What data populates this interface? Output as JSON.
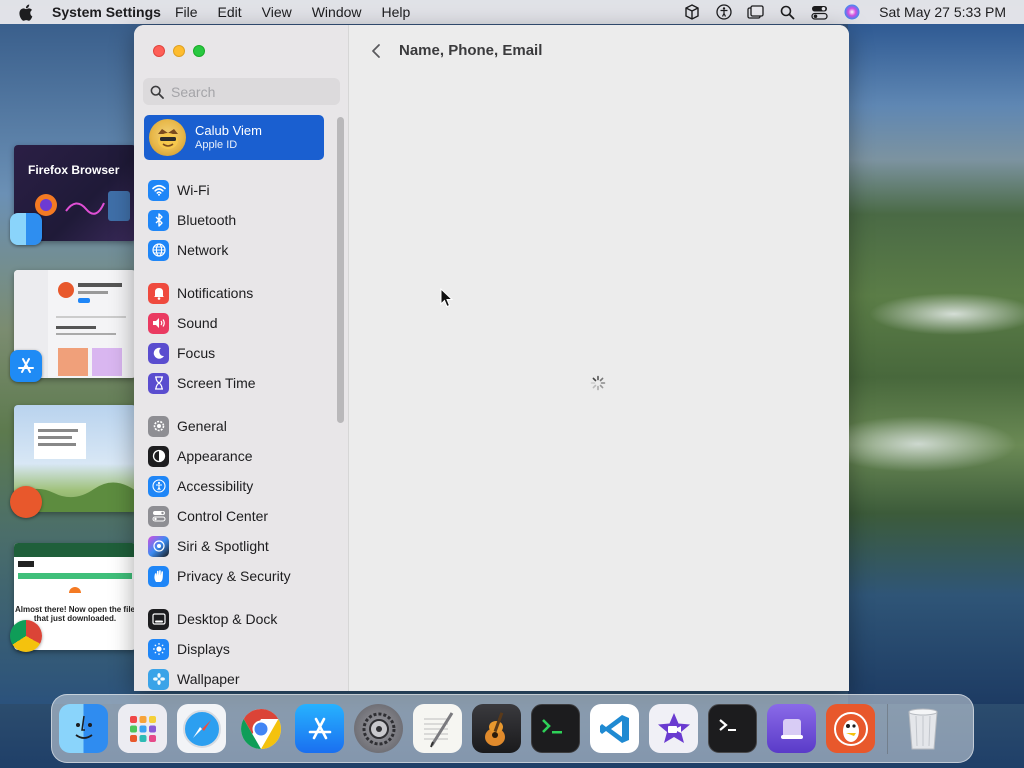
{
  "menubar": {
    "app_name": "System Settings",
    "menus": [
      "File",
      "Edit",
      "View",
      "Window",
      "Help"
    ],
    "clock": "Sat May 27  5:33 PM"
  },
  "stage_previews": {
    "firefox_title": "Firefox Browser",
    "download_message": "Almost there! Now open the file that just downloaded."
  },
  "window": {
    "search": {
      "placeholder": "Search"
    },
    "account": {
      "name": "Calub Viem",
      "subtitle": "Apple ID"
    },
    "sidebar": {
      "groups": [
        [
          {
            "label": "Wi-Fi",
            "icon": "wifi-icon",
            "color": "#1f86f7"
          },
          {
            "label": "Bluetooth",
            "icon": "bluetooth-icon",
            "color": "#1f86f7"
          },
          {
            "label": "Network",
            "icon": "globe-icon",
            "color": "#1f86f7"
          }
        ],
        [
          {
            "label": "Notifications",
            "icon": "bell-icon",
            "color": "#ef4a3e"
          },
          {
            "label": "Sound",
            "icon": "speaker-icon",
            "color": "#ea3a61"
          },
          {
            "label": "Focus",
            "icon": "moon-icon",
            "color": "#5a4dcf"
          },
          {
            "label": "Screen Time",
            "icon": "hourglass-icon",
            "color": "#5a4dcf"
          }
        ],
        [
          {
            "label": "General",
            "icon": "gear-icon",
            "color": "#8e8e93"
          },
          {
            "label": "Appearance",
            "icon": "appearance-icon",
            "color": "#1d1d1f"
          },
          {
            "label": "Accessibility",
            "icon": "accessibility-icon",
            "color": "#1f86f7"
          },
          {
            "label": "Control Center",
            "icon": "toggles-icon",
            "color": "#8e8e93"
          },
          {
            "label": "Siri & Spotlight",
            "icon": "siri-icon",
            "color": "#7a3cc8"
          },
          {
            "label": "Privacy & Security",
            "icon": "hand-icon",
            "color": "#1f86f7"
          }
        ],
        [
          {
            "label": "Desktop & Dock",
            "icon": "dock-icon",
            "color": "#1d1d1f"
          },
          {
            "label": "Displays",
            "icon": "sun-icon",
            "color": "#1f86f7"
          },
          {
            "label": "Wallpaper",
            "icon": "flower-icon",
            "color": "#3aa3e8"
          }
        ]
      ]
    },
    "content": {
      "title": "Name, Phone, Email"
    }
  },
  "dock": {
    "apps": [
      {
        "name": "finder",
        "color": "#2f8cf0"
      },
      {
        "name": "launchpad",
        "color": "#e9e9ef"
      },
      {
        "name": "safari",
        "color": "#f2f4f7"
      },
      {
        "name": "chrome",
        "color": "#ffffff"
      },
      {
        "name": "app-store",
        "color": "#1f8bf5"
      },
      {
        "name": "system-settings",
        "color": "#8a8a90"
      },
      {
        "name": "textedit",
        "color": "#f4f4f0"
      },
      {
        "name": "garageband",
        "color": "#2a2a2e"
      },
      {
        "name": "terminal-green",
        "color": "#1c1c1e"
      },
      {
        "name": "vscode",
        "color": "#ffffff"
      },
      {
        "name": "imovie",
        "color": "#f0f0f6"
      },
      {
        "name": "terminal",
        "color": "#1c1c1e"
      },
      {
        "name": "apple-configurator",
        "color": "#6a4bd6"
      },
      {
        "name": "duckduckgo",
        "color": "#e8582c"
      }
    ],
    "trash": {
      "name": "trash",
      "color": "#e4e6ea"
    }
  }
}
